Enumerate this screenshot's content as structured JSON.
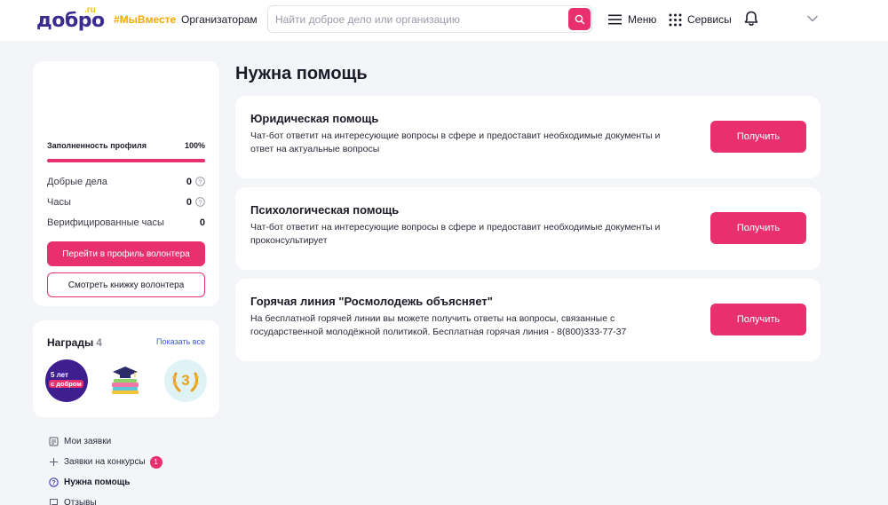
{
  "header": {
    "logo_text": "добро",
    "logo_suffix": ".ru",
    "hashtag": "#МыВместе",
    "organizers_link": "Организаторам",
    "search_placeholder": "Найти доброе дело или организацию",
    "menu_label": "Меню",
    "services_label": "Сервисы"
  },
  "profile": {
    "fill_label": "Заполненность профиля",
    "fill_value": "100%",
    "fill_fraction": 1.0,
    "stats": [
      {
        "label": "Добрые дела",
        "value": "0"
      },
      {
        "label": "Часы",
        "value": "0"
      },
      {
        "label": "Верифицированные часы",
        "value": "0"
      }
    ],
    "primary_button": "Перейти в профиль волонтера",
    "secondary_button": "Смотреть книжку волонтера"
  },
  "awards": {
    "title": "Награды",
    "count": "4",
    "show_all": "Показать все",
    "badge1_line1": "5 лет",
    "badge1_line2": "с добром",
    "badge3_number": "3"
  },
  "side_nav": [
    {
      "label": "Мои заявки",
      "icon": "document-icon"
    },
    {
      "label": "Заявки на конкурсы",
      "icon": "plus-icon",
      "badge": "1"
    },
    {
      "label": "Нужна помощь",
      "icon": "help-circle-icon",
      "active": true
    },
    {
      "label": "Отзывы",
      "icon": "chat-icon"
    }
  ],
  "main": {
    "title": "Нужна помощь",
    "cards": [
      {
        "title": "Юридическая помощь",
        "description": "Чат-бот ответит на интересующие вопросы в сфере и предоставит необходимые документы и ответ на актуальные вопросы",
        "button": "Получить"
      },
      {
        "title": "Психологическая помощь",
        "description": "Чат-бот ответит на интересующие вопросы в сфере и предоставит необходимые документы и проконсультирует",
        "button": "Получить"
      },
      {
        "title": "Горячая линия \"Росмолодежь объясняет\"",
        "description": "На бесплатной горячей линии вы можете получить ответы на вопросы, связанные с государственной молодёжной политикой. Бесплатная горячая линия - 8(800)333-77-37",
        "button": "Получить"
      }
    ]
  },
  "colors": {
    "accent": "#e8306e",
    "brand": "#3b2b8f",
    "hashtag": "#f5a800",
    "link": "#3b5bdb",
    "background": "#f4f5f9"
  }
}
